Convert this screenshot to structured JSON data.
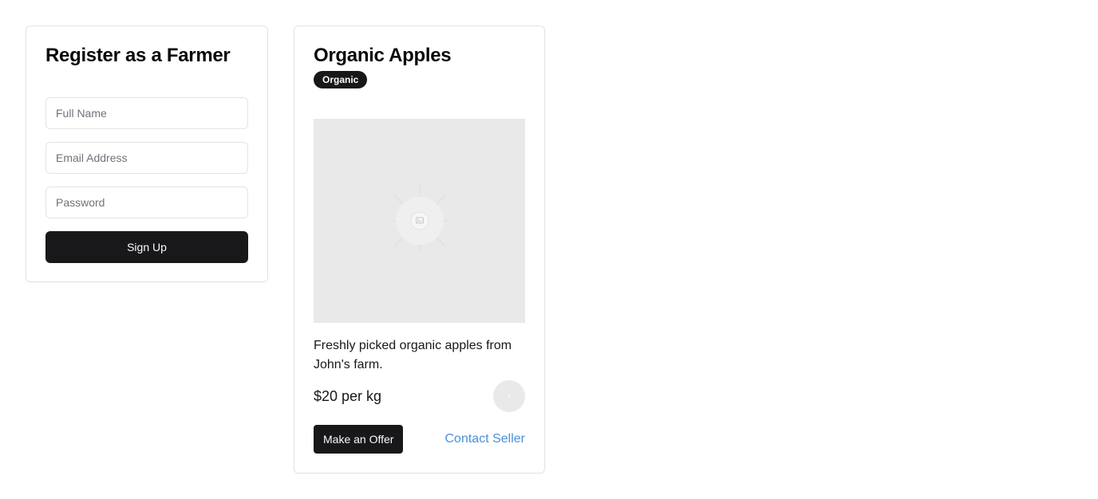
{
  "register": {
    "title": "Register as a Farmer",
    "full_name_placeholder": "Full Name",
    "email_placeholder": "Email Address",
    "password_placeholder": "Password",
    "submit_label": "Sign Up"
  },
  "product": {
    "title": "Organic Apples",
    "badge": "Organic",
    "image_icon": "image-placeholder-icon",
    "description": "Freshly picked organic apples from John's farm.",
    "price": "$20 per kg",
    "offer_label": "Make an Offer",
    "contact_label": "Contact Seller"
  },
  "colors": {
    "primary": "#18181b",
    "link": "#4a90d9",
    "placeholder_bg": "#e9e9e9",
    "border": "#e4e4e7"
  }
}
